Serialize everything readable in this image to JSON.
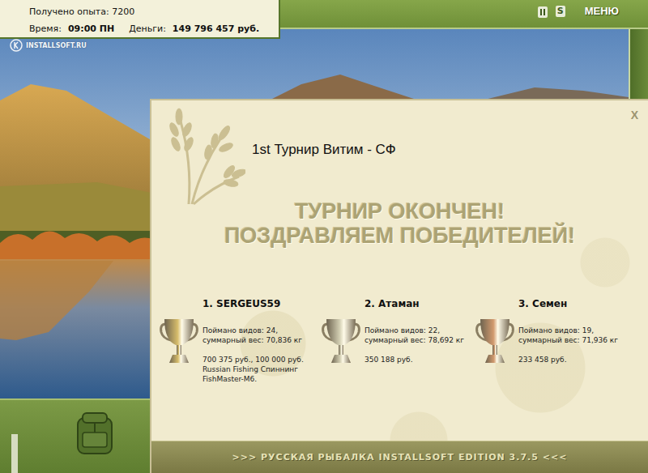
{
  "hud": {
    "experience": "Получено опыта: 7200",
    "time_label": "Время:",
    "time": "09:00 ПН",
    "money_label": "Деньги:",
    "money": "149 796 457 руб."
  },
  "watermark": "INSTALLSOFT.RU",
  "toolbar": {
    "settings": "S",
    "menu": "МЕНЮ"
  },
  "dialog": {
    "close": "X",
    "title": "1st Турнир Витим - СФ",
    "headline": [
      "ТУРНИР ОКОНЧЕН!",
      "ПОЗДРАВЛЯЕМ ПОБЕДИТЕЛЕЙ!"
    ],
    "winners": [
      {
        "name": "1. SERGEUS59",
        "stats": [
          "Поймано видов: 24,",
          "суммарный вес: 70,836 кг"
        ],
        "prizes": [
          "700 375 руб., 100 000 руб.",
          "Russian Fishing Спиннинг",
          "FishMaster-M6."
        ],
        "color": "#d6bc6a"
      },
      {
        "name": "2. Атаман",
        "stats": [
          "Поймано видов: 22,",
          "суммарный вес: 78,692 кг"
        ],
        "prizes": [
          "350 188 руб."
        ],
        "color": "#d2ceb2"
      },
      {
        "name": "3. Семен",
        "stats": [
          "Поймано видов: 19,",
          "суммарный вес: 71,936 кг"
        ],
        "prizes": [
          "233 458 руб."
        ],
        "color": "#d29a6e"
      }
    ]
  },
  "footer": ">>> РУССКАЯ РЫБАЛКА INSTALLSOFT EDITION 3.7.5 <<<"
}
